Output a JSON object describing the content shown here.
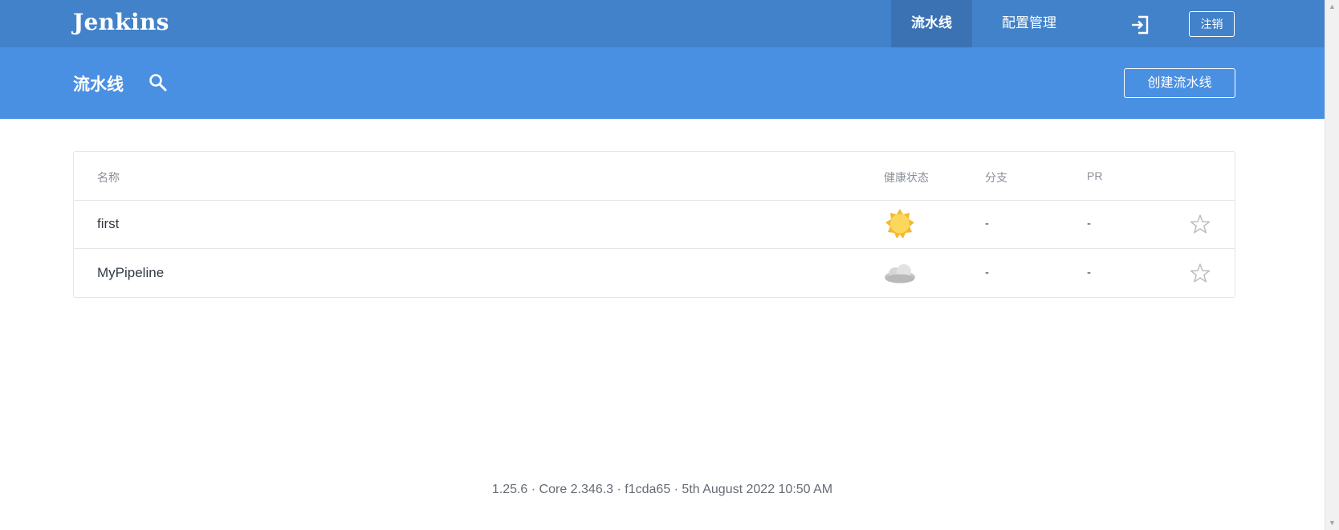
{
  "header": {
    "brand": "Jenkins",
    "nav": [
      {
        "label": "流水线",
        "active": true
      },
      {
        "label": "配置管理",
        "active": false
      }
    ],
    "logout_label": "注销",
    "exit_icon": "login-arrow-icon"
  },
  "subheader": {
    "title": "流水线",
    "search_icon": "search-icon",
    "create_label": "创建流水线"
  },
  "table": {
    "columns": [
      "名称",
      "健康状态",
      "分支",
      "PR"
    ],
    "rows": [
      {
        "name": "first",
        "health": "sunny-weather-icon",
        "branch": "-",
        "pr": "-",
        "favorite_icon": "star-outline-icon"
      },
      {
        "name": "MyPipeline",
        "health": "cloudy-weather-icon",
        "branch": "-",
        "pr": "-",
        "favorite_icon": "star-outline-icon"
      }
    ]
  },
  "footer": {
    "text": "1.25.6 · Core 2.346.3 · f1cda65 · 5th August 2022 10:50 AM"
  },
  "colors": {
    "topbar": "#4282ca",
    "topbar_active_tab": "#3a72b4",
    "subbar": "#4a90e2",
    "sun": "#f8d24a",
    "cloud": "#cfcfcf"
  }
}
